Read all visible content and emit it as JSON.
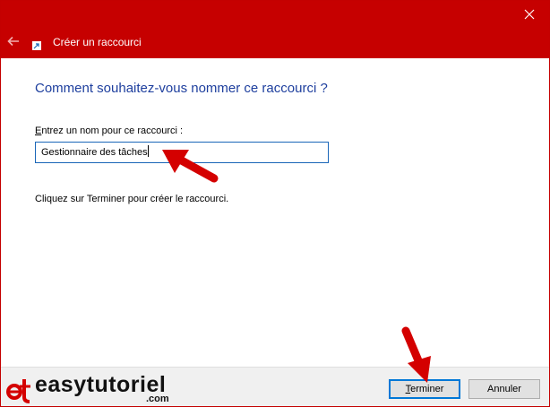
{
  "titlebar": {
    "title": "Créer un raccourci",
    "back_icon": "back-arrow-icon",
    "close_icon": "close-icon",
    "color": "#c60000"
  },
  "main": {
    "heading": "Comment souhaitez-vous nommer ce raccourci ?",
    "field_label_accesskey": "E",
    "field_label_rest": "ntrez un nom pour ce raccourci :",
    "name_value": "Gestionnaire des tâches",
    "hint": "Cliquez sur Terminer pour créer le raccourci.",
    "heading_color": "#1e3f9e"
  },
  "footer": {
    "finish_accesskey": "T",
    "finish_rest": "erminer",
    "cancel_label": "Annuler",
    "accent": "#0078d7"
  },
  "watermark": {
    "text": "easytutoriel",
    "suffix": ".com",
    "annotation_color": "#d40000"
  }
}
